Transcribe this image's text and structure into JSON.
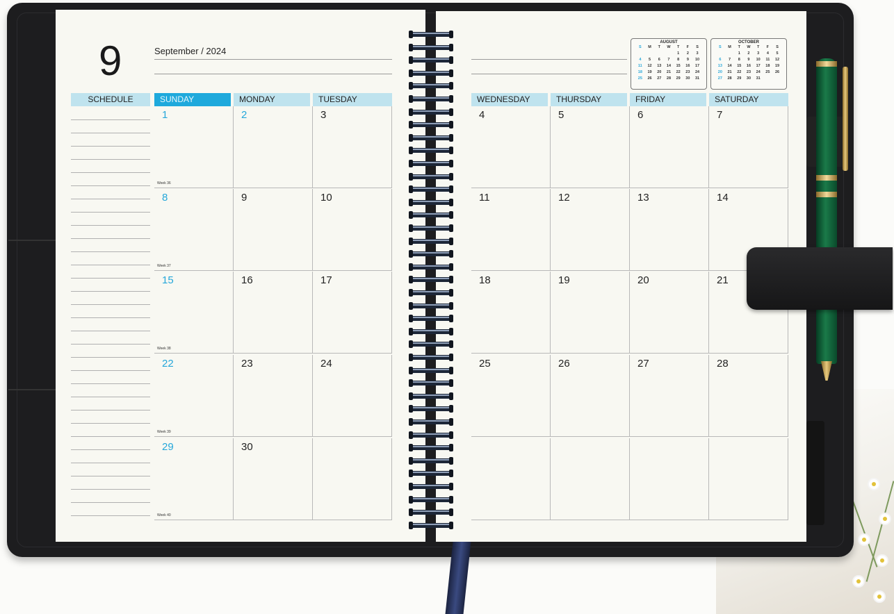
{
  "planner": {
    "month_number": "9",
    "month_title": "September / 2024",
    "schedule_label": "SCHEDULE",
    "weekdays_left": [
      "SUNDAY",
      "MONDAY",
      "TUESDAY"
    ],
    "weekdays_right": [
      "WEDNESDAY",
      "THURSDAY",
      "FRIDAY",
      "SATURDAY"
    ],
    "weeks": [
      {
        "label": "Week 36",
        "days": [
          "1",
          "2",
          "3",
          "4",
          "5",
          "6",
          "7"
        ]
      },
      {
        "label": "Week 37",
        "days": [
          "8",
          "9",
          "10",
          "11",
          "12",
          "13",
          "14"
        ]
      },
      {
        "label": "Week 38",
        "days": [
          "15",
          "16",
          "17",
          "18",
          "19",
          "20",
          "21"
        ]
      },
      {
        "label": "Week 39",
        "days": [
          "22",
          "23",
          "24",
          "25",
          "26",
          "27",
          "28"
        ]
      },
      {
        "label": "Week 40",
        "days": [
          "29",
          "30",
          "",
          "",
          "",
          "",
          ""
        ]
      }
    ],
    "highlight_color": "#25a7da",
    "header_color": "#bfe3ee"
  },
  "mini_calendars": [
    {
      "title": "AUGUST",
      "header": [
        "S",
        "M",
        "T",
        "W",
        "T",
        "F",
        "S"
      ],
      "rows": [
        [
          "",
          "",
          "",
          "",
          "1",
          "2",
          "3"
        ],
        [
          "4",
          "5",
          "6",
          "7",
          "8",
          "9",
          "10"
        ],
        [
          "11",
          "12",
          "13",
          "14",
          "15",
          "16",
          "17"
        ],
        [
          "18",
          "19",
          "20",
          "21",
          "22",
          "23",
          "24"
        ],
        [
          "25",
          "26",
          "27",
          "28",
          "29",
          "30",
          "31"
        ]
      ]
    },
    {
      "title": "OCTOBER",
      "header": [
        "S",
        "M",
        "T",
        "W",
        "T",
        "F",
        "S"
      ],
      "rows": [
        [
          "",
          "",
          "1",
          "2",
          "3",
          "4",
          "5"
        ],
        [
          "6",
          "7",
          "8",
          "9",
          "10",
          "11",
          "12"
        ],
        [
          "13",
          "14",
          "15",
          "16",
          "17",
          "18",
          "19"
        ],
        [
          "20",
          "21",
          "22",
          "23",
          "24",
          "25",
          "26"
        ],
        [
          "27",
          "28",
          "29",
          "30",
          "31",
          "",
          ""
        ]
      ]
    }
  ],
  "colors": {
    "cover": "#1d1d1f",
    "page": "#f8f8f2",
    "pen": "#1a7a49"
  }
}
